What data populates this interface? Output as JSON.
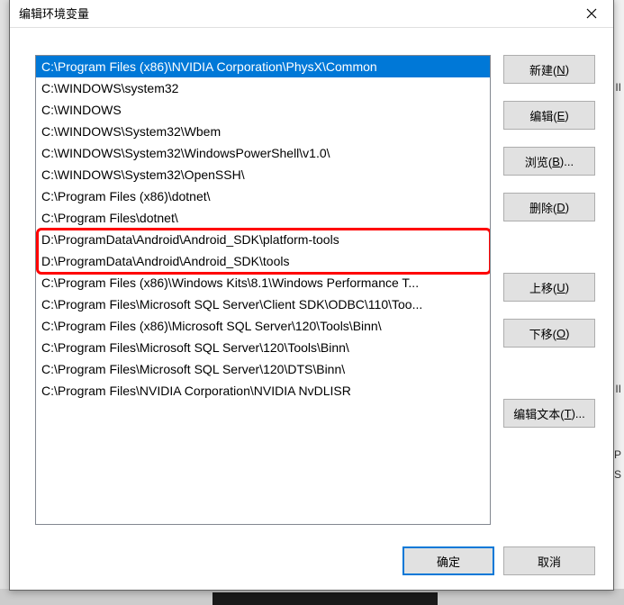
{
  "dialog": {
    "title": "编辑环境变量"
  },
  "list": {
    "items": [
      "C:\\Program Files (x86)\\NVIDIA Corporation\\PhysX\\Common",
      "C:\\WINDOWS\\system32",
      "C:\\WINDOWS",
      "C:\\WINDOWS\\System32\\Wbem",
      "C:\\WINDOWS\\System32\\WindowsPowerShell\\v1.0\\",
      "C:\\WINDOWS\\System32\\OpenSSH\\",
      "C:\\Program Files (x86)\\dotnet\\",
      "C:\\Program Files\\dotnet\\",
      "D:\\ProgramData\\Android\\Android_SDK\\platform-tools",
      "D:\\ProgramData\\Android\\Android_SDK\\tools",
      "C:\\Program Files (x86)\\Windows Kits\\8.1\\Windows Performance T...",
      "C:\\Program Files\\Microsoft SQL Server\\Client SDK\\ODBC\\110\\Too...",
      "C:\\Program Files (x86)\\Microsoft SQL Server\\120\\Tools\\Binn\\",
      "C:\\Program Files\\Microsoft SQL Server\\120\\Tools\\Binn\\",
      "C:\\Program Files\\Microsoft SQL Server\\120\\DTS\\Binn\\",
      "C:\\Program Files\\NVIDIA Corporation\\NVIDIA NvDLISR"
    ],
    "selected_index": 0,
    "highlight_start": 8,
    "highlight_end": 9
  },
  "buttons": {
    "new": {
      "label": "新建(",
      "accel": "N",
      "suffix": ")"
    },
    "edit": {
      "label": "编辑(",
      "accel": "E",
      "suffix": ")"
    },
    "browse": {
      "label": "浏览(",
      "accel": "B",
      "suffix": ")..."
    },
    "delete": {
      "label": "删除(",
      "accel": "D",
      "suffix": ")"
    },
    "moveup": {
      "label": "上移(",
      "accel": "U",
      "suffix": ")"
    },
    "movedown": {
      "label": "下移(",
      "accel": "O",
      "suffix": ")"
    },
    "edittext": {
      "label": "编辑文本(",
      "accel": "T",
      "suffix": ")..."
    },
    "ok": "确定",
    "cancel": "取消"
  },
  "bg_hints": {
    "r1": "II",
    "r2": "II",
    "r3": "P",
    "r4": "S"
  }
}
